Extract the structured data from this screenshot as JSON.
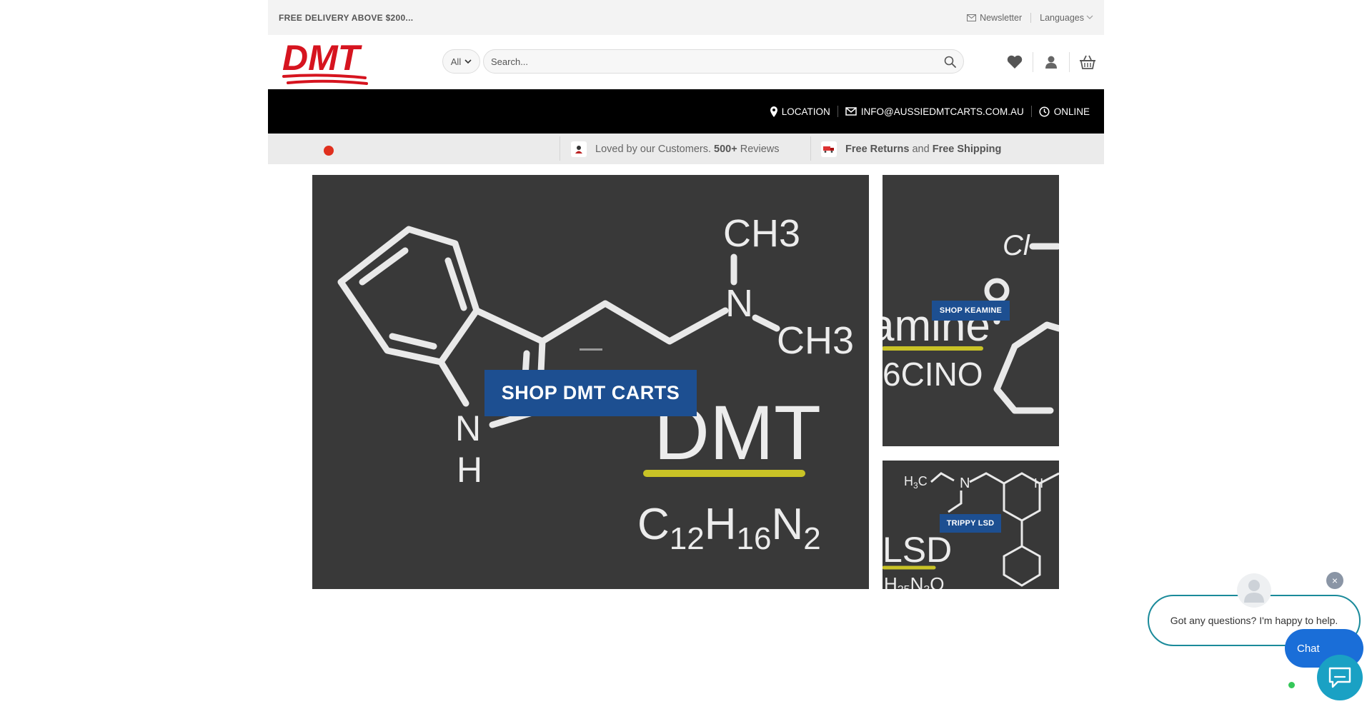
{
  "topbar": {
    "promo": "FREE DELIVERY ABOVE $200...",
    "newsletter": "Newsletter",
    "languages": "Languages"
  },
  "header": {
    "logo_text": "DMT",
    "category_select": "All",
    "search_placeholder": "Search..."
  },
  "navbar": {
    "location": "LOCATION",
    "email": "INFO@AUSSIEDMTCARTS.COM.AU",
    "online": "ONLINE"
  },
  "trust": {
    "loved_prefix": "Loved by our Customers.",
    "loved_count": "500+",
    "loved_suffix": "Reviews",
    "returns_bold": "Free Returns",
    "returns_and": "and",
    "shipping_bold": "Free Shipping"
  },
  "hero": {
    "cta": "SHOP DMT CARTS",
    "formula_name": "DMT",
    "ch3_top": "CH3",
    "ch3_right": "CH3",
    "n_atom": "N",
    "nh_n": "N",
    "nh_h": "H"
  },
  "side_banners": [
    {
      "cta": "SHOP KEAMINE",
      "art_text": "amine",
      "art_sub": "6CINO",
      "art_cl": "Cl"
    },
    {
      "cta": "TRIPPY LSD",
      "art_text": "LSD"
    }
  ],
  "chat": {
    "message": "Got any questions? I'm happy to help.",
    "button": "Chat",
    "close": "×"
  },
  "colors": {
    "brand_red": "#d6141f",
    "cta_blue": "#1d4f91",
    "chat_teal": "#1a8a9a",
    "chat_blue": "#1a6ed8"
  }
}
